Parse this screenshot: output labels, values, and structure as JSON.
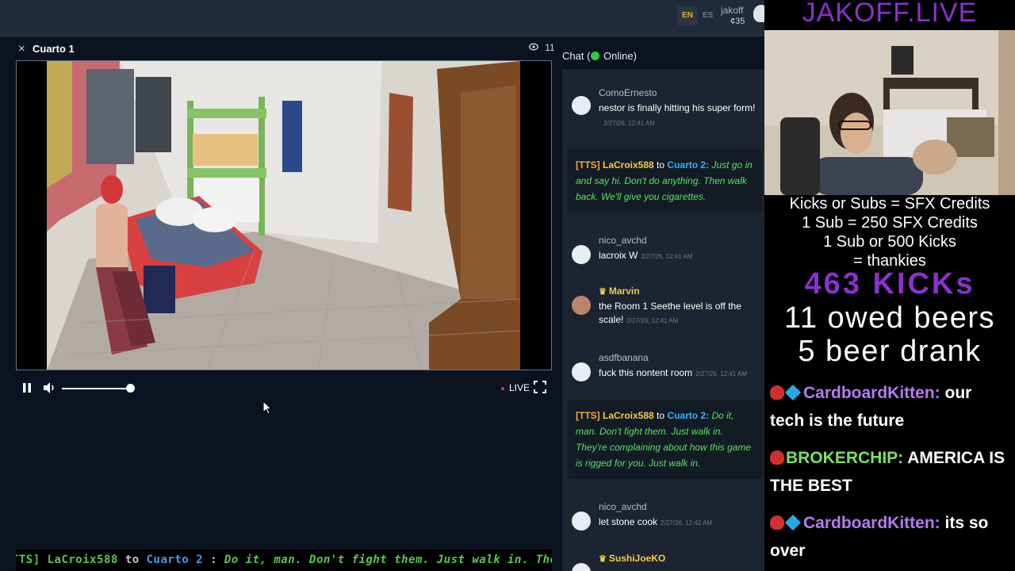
{
  "topbar": {
    "lang_en": "EN",
    "lang_es": "ES",
    "username": "jakoff",
    "coins": "¢35"
  },
  "room": {
    "title": "Cuarto 1",
    "viewers": "11"
  },
  "player": {
    "live_label": "LIVE",
    "volume": 1.0
  },
  "ticker": {
    "tag": "[TTS]",
    "from": "LaCroix588",
    "to_word": "to",
    "target": "Cuarto 2",
    "sep": ":",
    "message": "Do it, man. Don't fight them. Just walk in. They're complaining about how this game is rigged for you. Just walk in."
  },
  "chat": {
    "header_prefix": "Chat (",
    "header_status": "Online)",
    "messages": [
      {
        "user": "ComoErnesto",
        "text": "nestor is finally hitting his super form!",
        "time": "2/27/26, 12:41 AM"
      },
      {
        "tag": "[TTS]",
        "from": "LaCroix588",
        "to_word": "to",
        "target": "Cuarto 2",
        "text": "Just go in and say hi. Don't do anything. Then walk back. We'll give you cigarettes."
      },
      {
        "user": "nico_avchd",
        "text": "lacroix W",
        "time": "2/27/26, 12:41 AM"
      },
      {
        "user": "Marvin",
        "text": "the Room 1 Seethe level is off the scale!",
        "time": "2/27/26, 12:41 AM"
      },
      {
        "user": "asdfbanana",
        "text": "fuck this nontent room",
        "time": "2/27/26, 12:41 AM"
      },
      {
        "tag": "[TTS]",
        "from": "LaCroix588",
        "to_word": "to",
        "target": "Cuarto 2",
        "text": "Do it, man. Don't fight them. Just walk in. They're complaining about how this game is rigged for you. Just walk in."
      },
      {
        "user": "nico_avchd",
        "text": "let stone cook",
        "time": "2/27/26, 12:42 AM"
      },
      {
        "user": "SushiJoeKO",
        "text": "",
        "time": ""
      }
    ]
  },
  "overlay": {
    "title": "JAKOFF.LIVE",
    "rules": [
      "Kicks or Subs = SFX Credits",
      "1 Sub = 250 SFX Credits",
      "1 Sub or 500 Kicks",
      "= thankies"
    ],
    "kicks": "463 KICKs",
    "owed_beers": "11 owed beers",
    "beer_drank": "5 beer drank",
    "chat": [
      {
        "user": "CardboardKitten:",
        "text": "our tech is the future"
      },
      {
        "user": "BROKERCHIP:",
        "text": "AMERICA IS THE BEST"
      },
      {
        "user": "CardboardKitten:",
        "text": "its so over"
      }
    ]
  },
  "colors": {
    "accent": "#f2a93b",
    "online": "#2fcc4a",
    "tts_body": "#58e064",
    "overlay_purple": "#8a32cc"
  }
}
